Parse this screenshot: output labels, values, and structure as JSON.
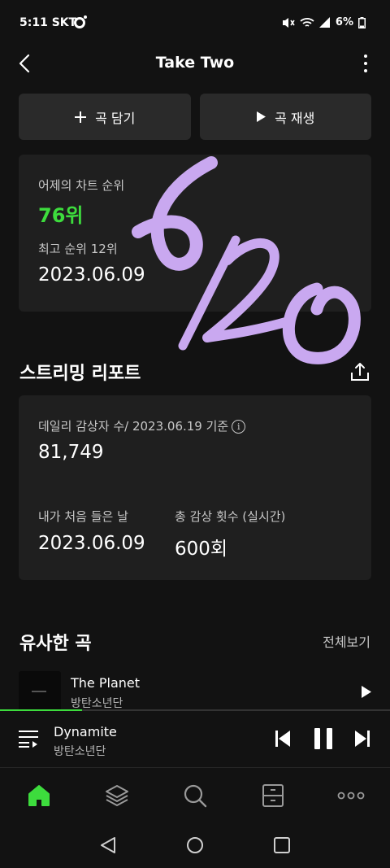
{
  "status_bar": {
    "time": "5:11",
    "carrier": "SKT",
    "battery": "6%"
  },
  "header": {
    "title": "Take Two"
  },
  "actions": {
    "add_label": "곡 담기",
    "play_label": "곡 재생"
  },
  "chart": {
    "yesterday_label": "어제의 차트 순위",
    "yesterday_rank": "76위",
    "peak_label": "최고 순위 12위",
    "peak_date": "2023.06.09"
  },
  "watermark_text": "6/20",
  "streaming": {
    "title": "스트리밍 리포트",
    "daily_label": "데일리 감상자 수/ 2023.06.19 기준",
    "daily_value": "81,749",
    "first_listen_label": "내가 처음 들은 날",
    "first_listen_value": "2023.06.09",
    "total_plays_label": "총 감상 횟수 (실시간)",
    "total_plays_value": "600회"
  },
  "similar": {
    "title": "유사한 곡",
    "view_all": "전체보기",
    "songs": [
      {
        "title": "The Planet",
        "artist": "방탄소년단"
      }
    ]
  },
  "player": {
    "title": "Dynamite",
    "artist": "방탄소년단",
    "progress": 0.21
  },
  "bottom_nav": [
    "home-icon",
    "layers-icon",
    "search-icon",
    "library-icon",
    "more-icon"
  ],
  "colors": {
    "accent": "#3ddc3d",
    "background": "#121212",
    "card": "#1f1f1f",
    "watermark": "#c9a8f0"
  }
}
